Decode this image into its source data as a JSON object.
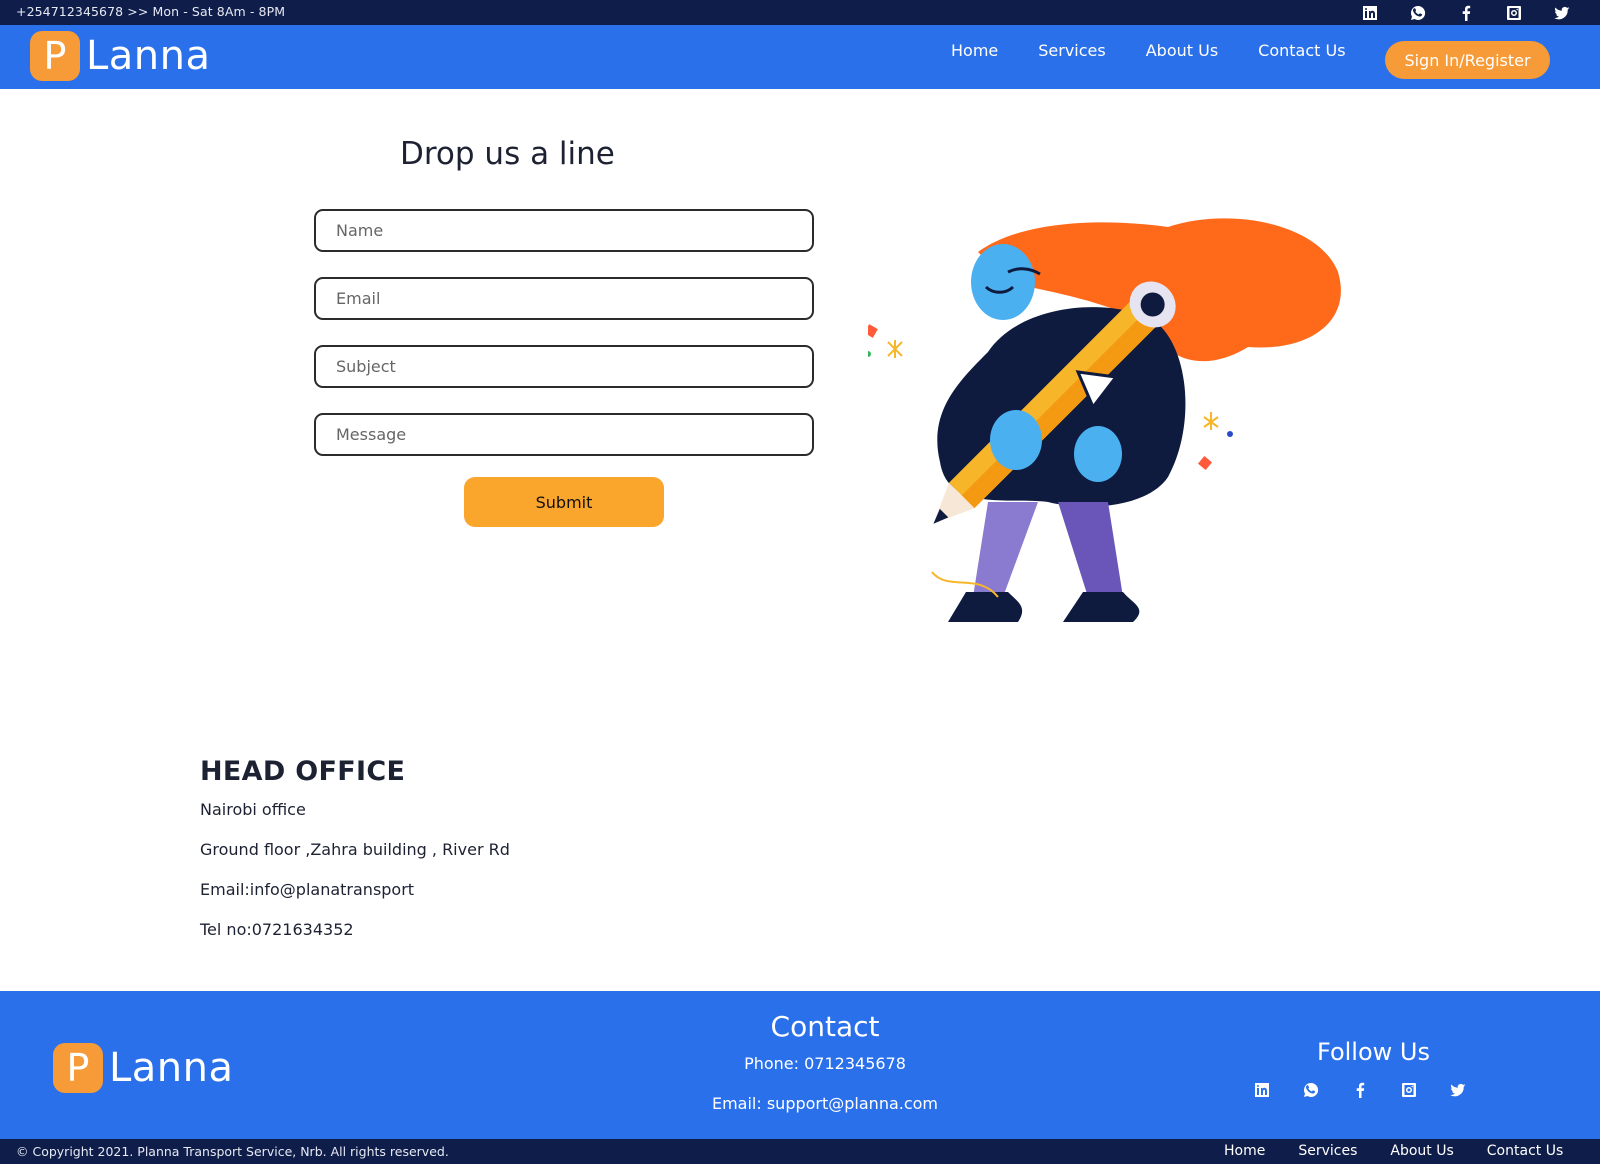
{
  "topbar": {
    "info": "+254712345678 >> Mon - Sat 8Am - 8PM",
    "socials": [
      "linkedin-icon",
      "whatsapp-icon",
      "facebook-icon",
      "instagram-icon",
      "twitter-icon"
    ]
  },
  "header": {
    "logo_letter": "P",
    "logo_text": "Lanna",
    "nav": [
      "Home",
      "Services",
      "About Us",
      "Contact Us"
    ],
    "signin_label": "Sign In/Register"
  },
  "form": {
    "title": "Drop us a line",
    "name_placeholder": "Name",
    "email_placeholder": "Email",
    "subject_placeholder": "Subject",
    "message_placeholder": "Message",
    "submit_label": "Submit"
  },
  "office": {
    "title": "HEAD OFFICE",
    "lines": [
      "Nairobi office",
      "Ground floor ,Zahra building , River Rd",
      "Email:info@planatransport",
      "Tel no:0721634352"
    ]
  },
  "footer": {
    "logo_letter": "P",
    "logo_text": "Lanna",
    "contact_title": "Contact",
    "phone": "Phone: 0712345678",
    "email": "Email: support@planna.com",
    "follow_title": "Follow Us",
    "copyright": "© Copyright 2021. Planna Transport Service, Nrb. All rights reserved.",
    "nav": [
      "Home",
      "Services",
      "About Us",
      "Contact Us"
    ]
  },
  "colors": {
    "header_blue": "#2a70ea",
    "dark_navy": "#0f1d4a",
    "accent_orange": "#f79a38",
    "submit_orange": "#faa52c"
  }
}
